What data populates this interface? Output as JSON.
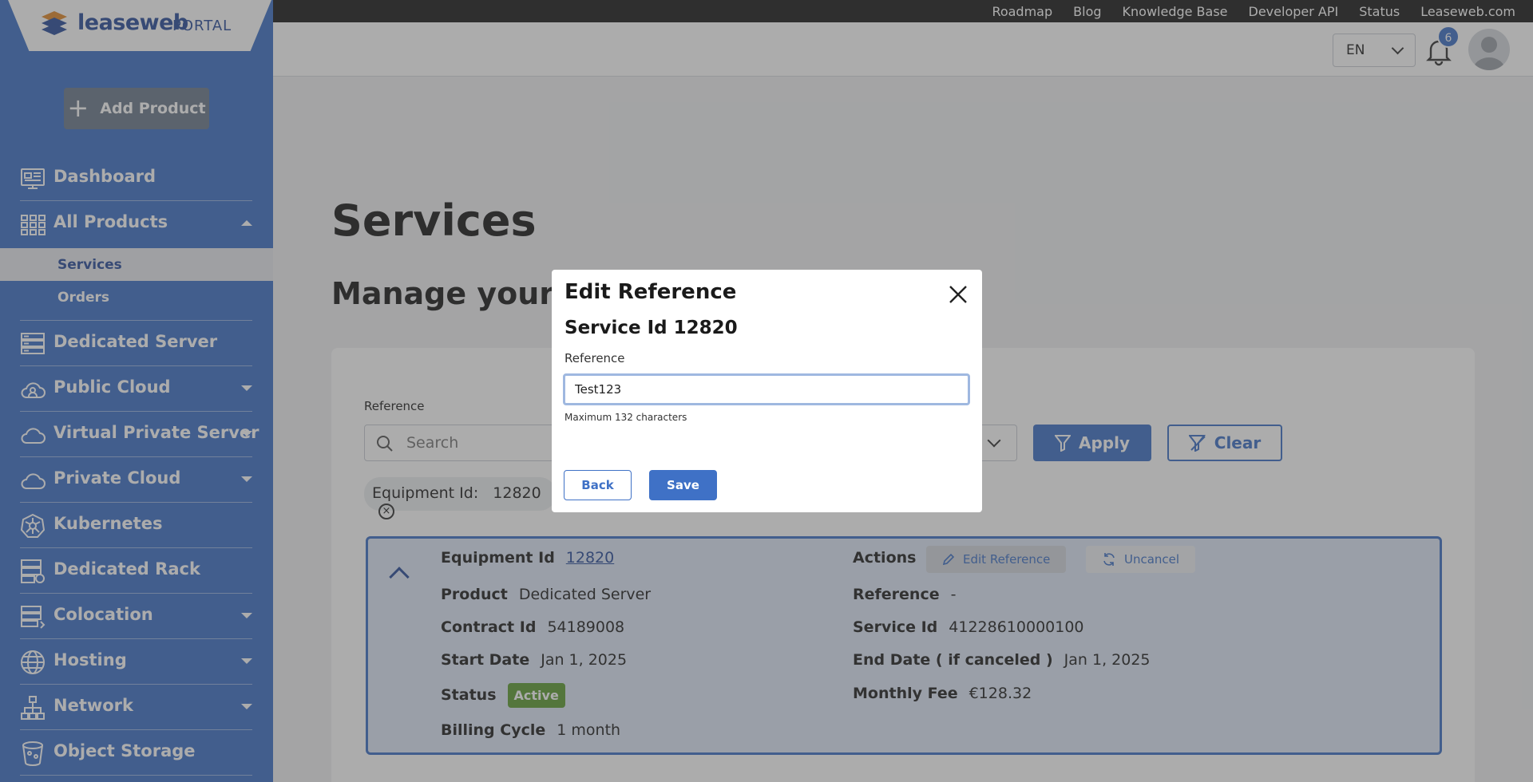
{
  "topbar": {
    "links": [
      "Roadmap",
      "Blog",
      "Knowledge Base",
      "Developer API",
      "Status",
      "Leaseweb.com"
    ]
  },
  "brand": {
    "name": "leaseweb",
    "portal": "PORTAL"
  },
  "sidebar": {
    "add_product": "Add Product",
    "items": [
      {
        "label": "Dashboard",
        "icon": "dashboard-icon"
      },
      {
        "label": "All Products",
        "icon": "grid-icon"
      },
      {
        "label": "Dedicated Server",
        "icon": "server-icon"
      },
      {
        "label": "Public Cloud",
        "icon": "cloud-icon"
      },
      {
        "label": "Virtual Private Server",
        "icon": "vps-cloud-icon"
      },
      {
        "label": "Private Cloud",
        "icon": "private-cloud-icon"
      },
      {
        "label": "Kubernetes",
        "icon": "kubernetes-icon"
      },
      {
        "label": "Dedicated Rack",
        "icon": "rack-icon"
      },
      {
        "label": "Colocation",
        "icon": "colocation-icon"
      },
      {
        "label": "Hosting",
        "icon": "globe-icon"
      },
      {
        "label": "Network",
        "icon": "network-icon"
      },
      {
        "label": "Object Storage",
        "icon": "bucket-icon"
      }
    ],
    "sub_items": [
      "Services",
      "Orders"
    ]
  },
  "header": {
    "lang": "EN",
    "notifications": "6"
  },
  "main": {
    "title": "Services",
    "subtitle": "Manage your se",
    "filter": {
      "label": "Reference",
      "search_placeholder": "Search",
      "apply": "Apply",
      "clear": "Clear"
    },
    "chip": {
      "label": "Equipment Id:",
      "value": "12820"
    },
    "card": {
      "equipment_label": "Equipment Id",
      "equipment_value": "12820",
      "product_label": "Product",
      "product_value": "Dedicated Server",
      "contract_label": "Contract Id",
      "contract_value": "54189008",
      "start_label": "Start Date",
      "start_value": "Jan 1, 2025",
      "status_label": "Status",
      "status_value": "Active",
      "billing_label": "Billing Cycle",
      "billing_value": "1 month",
      "actions_label": "Actions",
      "edit_reference": "Edit Reference",
      "uncancel": "Uncancel",
      "reference_label": "Reference",
      "reference_value": "-",
      "service_label": "Service Id",
      "service_value": "41228610000100",
      "end_label": "End Date ( if canceled )",
      "end_value": "Jan 1, 2025",
      "fee_label": "Monthly Fee",
      "fee_value": "€128.32"
    }
  },
  "modal": {
    "title": "Edit Reference",
    "subtitle": "Service Id 12820",
    "field_label": "Reference",
    "field_value": "Test123",
    "hint": "Maximum 132 characters",
    "back": "Back",
    "save": "Save"
  },
  "colors": {
    "brand_blue": "#3f71c6",
    "active_green": "#5f9d34"
  }
}
